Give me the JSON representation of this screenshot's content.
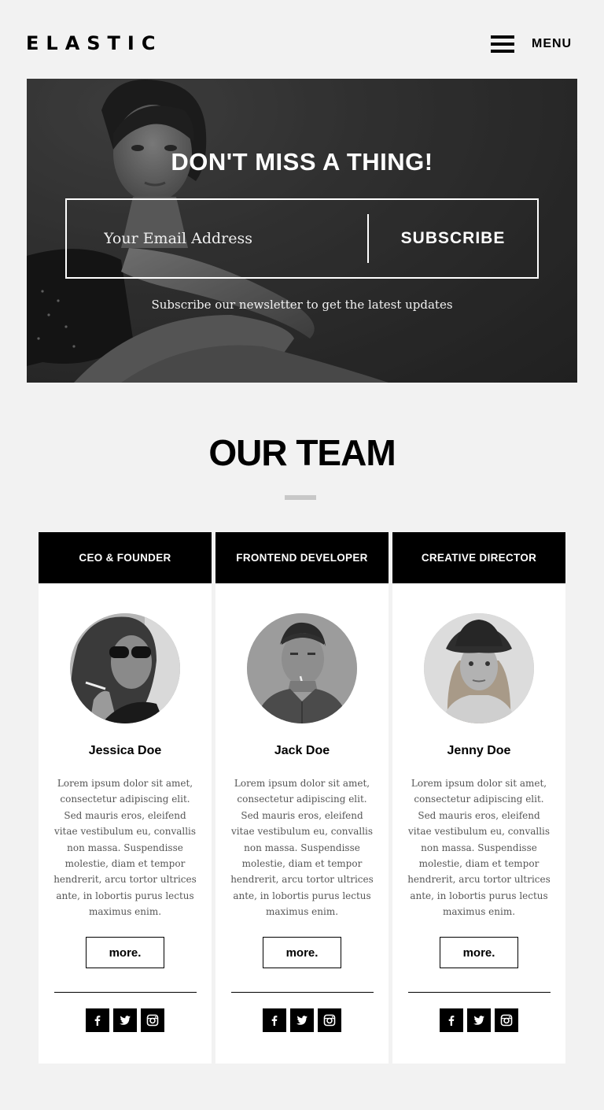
{
  "header": {
    "logo": "ELASTIC",
    "menu_label": "MENU"
  },
  "hero": {
    "title": "DON'T MISS A THING!",
    "email_placeholder": "Your Email Address",
    "subscribe_label": "SUBSCRIBE",
    "note": "Subscribe our newsletter to get the latest updates"
  },
  "team": {
    "title": "OUR TEAM",
    "members": [
      {
        "role": "CEO & FOUNDER",
        "name": "Jessica Doe",
        "bio": "Lorem ipsum dolor sit amet, consectetur adipiscing elit. Sed mauris eros, eleifend vitae vestibulum eu, convallis non massa. Suspendisse molestie, diam et tempor hendrerit, arcu tortor ultrices ante, in lobortis purus lectus maximus enim.",
        "more_label": "more."
      },
      {
        "role": "FRONTEND DEVELOPER",
        "name": "Jack Doe",
        "bio": "Lorem ipsum dolor sit amet, consectetur adipiscing elit. Sed mauris eros, eleifend vitae vestibulum eu, convallis non massa. Suspendisse molestie, diam et tempor hendrerit, arcu tortor ultrices ante, in lobortis purus lectus maximus enim.",
        "more_label": "more."
      },
      {
        "role": "CREATIVE DIRECTOR",
        "name": "Jenny Doe",
        "bio": "Lorem ipsum dolor sit amet, consectetur adipiscing elit. Sed mauris eros, eleifend vitae vestibulum eu, convallis non massa. Suspendisse molestie, diam et tempor hendrerit, arcu tortor ultrices ante, in lobortis purus lectus maximus enim.",
        "more_label": "more."
      }
    ],
    "social_icons": [
      "facebook-icon",
      "twitter-icon",
      "instagram-icon"
    ]
  },
  "colors": {
    "page_bg": "#f2f2f2",
    "accent": "#000000",
    "divider": "#c8c8c8"
  }
}
